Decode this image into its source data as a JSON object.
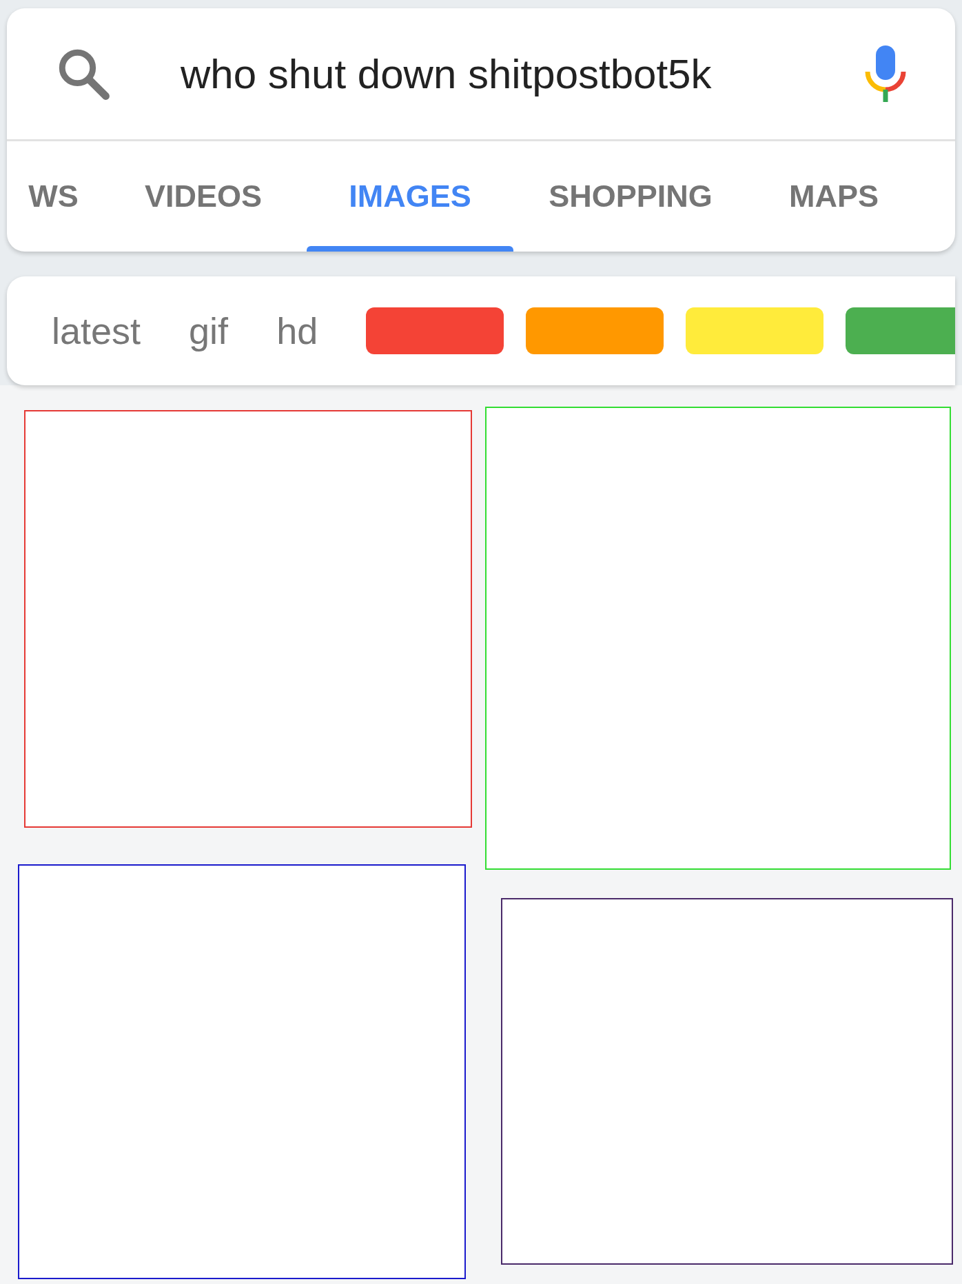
{
  "search": {
    "query": "who shut down shitpostbot5k"
  },
  "tabs": [
    {
      "label": "WS",
      "selected": false
    },
    {
      "label": "VIDEOS",
      "selected": false
    },
    {
      "label": "IMAGES",
      "selected": true
    },
    {
      "label": "SHOPPING",
      "selected": false
    },
    {
      "label": "MAPS",
      "selected": false
    }
  ],
  "filters": [
    {
      "kind": "text",
      "label": "latest"
    },
    {
      "kind": "text",
      "label": "gif"
    },
    {
      "kind": "text",
      "label": "hd"
    },
    {
      "kind": "color",
      "color": "#f44336"
    },
    {
      "kind": "color",
      "color": "#ff9800"
    },
    {
      "kind": "color",
      "color": "#ffeb3b"
    },
    {
      "kind": "color",
      "color": "#4caf50"
    }
  ],
  "results": [
    {
      "color": "#e53935"
    },
    {
      "color": "#33dd33"
    },
    {
      "color": "#1a1acc"
    },
    {
      "color": "#4a2a6a"
    }
  ]
}
